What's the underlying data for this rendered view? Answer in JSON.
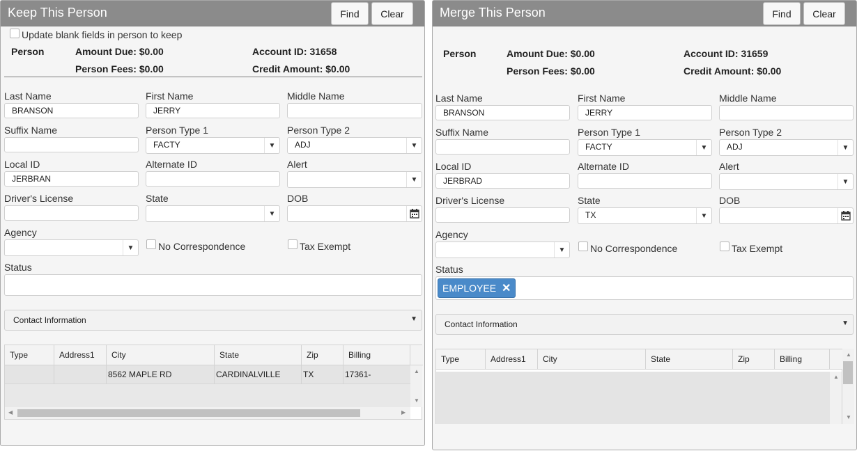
{
  "keep": {
    "title": "Keep This Person",
    "find_label": "Find",
    "clear_label": "Clear",
    "update_blank_label": "Update blank fields in person to keep",
    "summary": {
      "person_label": "Person",
      "amount_due": "Amount Due: $0.00",
      "person_fees": "Person Fees: $0.00",
      "account_id": "Account ID: 31658",
      "credit_amount": "Credit Amount: $0.00"
    },
    "fields": {
      "last_name_label": "Last Name",
      "last_name": "BRANSON",
      "first_name_label": "First Name",
      "first_name": "JERRY",
      "middle_name_label": "Middle Name",
      "middle_name": "",
      "suffix_label": "Suffix Name",
      "suffix": "",
      "type1_label": "Person Type 1",
      "type1": "FACTY",
      "type2_label": "Person Type 2",
      "type2": "ADJ",
      "local_id_label": "Local ID",
      "local_id": "JERBRAN",
      "alt_id_label": "Alternate ID",
      "alt_id": "",
      "alert_label": "Alert",
      "alert": "",
      "dl_label": "Driver's License",
      "dl": "",
      "state_label": "State",
      "state": "",
      "dob_label": "DOB",
      "dob": "",
      "agency_label": "Agency",
      "agency": "",
      "no_corr_label": "No Correspondence",
      "tax_exempt_label": "Tax Exempt",
      "status_label": "Status"
    },
    "contact_label": "Contact Information",
    "grid": {
      "columns": [
        "Type",
        "Address1",
        "City",
        "State",
        "Zip",
        "Billing"
      ],
      "rows": [
        {
          "type": "",
          "address1": "",
          "city": "8562 MAPLE RD",
          "state": "CARDINALVILLE",
          "zip": "TX",
          "billing": "17361-"
        }
      ]
    }
  },
  "merge": {
    "title": "Merge This Person",
    "find_label": "Find",
    "clear_label": "Clear",
    "summary": {
      "person_label": "Person",
      "amount_due": "Amount Due: $0.00",
      "person_fees": "Person Fees: $0.00",
      "account_id": "Account ID: 31659",
      "credit_amount": "Credit Amount: $0.00"
    },
    "fields": {
      "last_name_label": "Last Name",
      "last_name": "BRANSON",
      "first_name_label": "First Name",
      "first_name": "JERRY",
      "middle_name_label": "Middle Name",
      "middle_name": "",
      "suffix_label": "Suffix Name",
      "suffix": "",
      "type1_label": "Person Type 1",
      "type1": "FACTY",
      "type2_label": "Person Type 2",
      "type2": "ADJ",
      "local_id_label": "Local ID",
      "local_id": "JERBRAD",
      "alt_id_label": "Alternate ID",
      "alt_id": "",
      "alert_label": "Alert",
      "alert": "",
      "dl_label": "Driver's License",
      "dl": "",
      "state_label": "State",
      "state": "TX",
      "dob_label": "DOB",
      "dob": "",
      "agency_label": "Agency",
      "agency": "",
      "no_corr_label": "No Correspondence",
      "tax_exempt_label": "Tax Exempt",
      "status_label": "Status",
      "status_tag": "EMPLOYEE",
      "status_tag_remove": "✕"
    },
    "contact_label": "Contact Information",
    "grid": {
      "columns": [
        "Type",
        "Address1",
        "City",
        "State",
        "Zip",
        "Billing"
      ],
      "rows": []
    }
  },
  "icons": {
    "dropdown": "▼",
    "scroll_up": "▲",
    "scroll_down": "▼",
    "scroll_left": "◀",
    "scroll_right": "▶"
  }
}
